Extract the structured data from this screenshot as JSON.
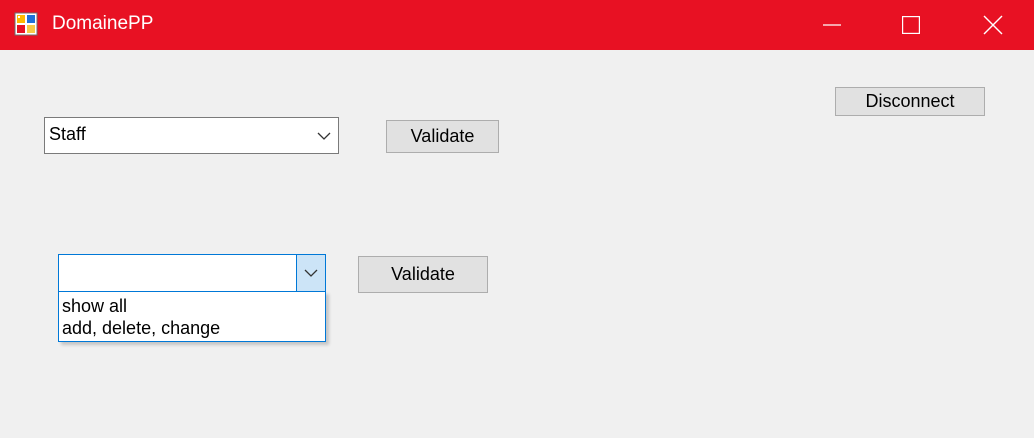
{
  "window": {
    "title": "DomainePP",
    "titlebar_color": "#e81123",
    "icons": [
      "app-icon",
      "minimize-icon",
      "maximize-icon",
      "close-icon"
    ]
  },
  "form": {
    "role_select": {
      "selected": "Staff"
    },
    "validate_role_label": "Validate",
    "permission_select": {
      "selected": "",
      "options": [
        "show all",
        "add, delete, change"
      ],
      "expanded": true
    },
    "validate_permission_label": "Validate",
    "disconnect_label": "Disconnect"
  },
  "colors": {
    "accent": "#0078d7",
    "form_background": "#f0f0f0",
    "button_background": "#e1e1e1"
  }
}
